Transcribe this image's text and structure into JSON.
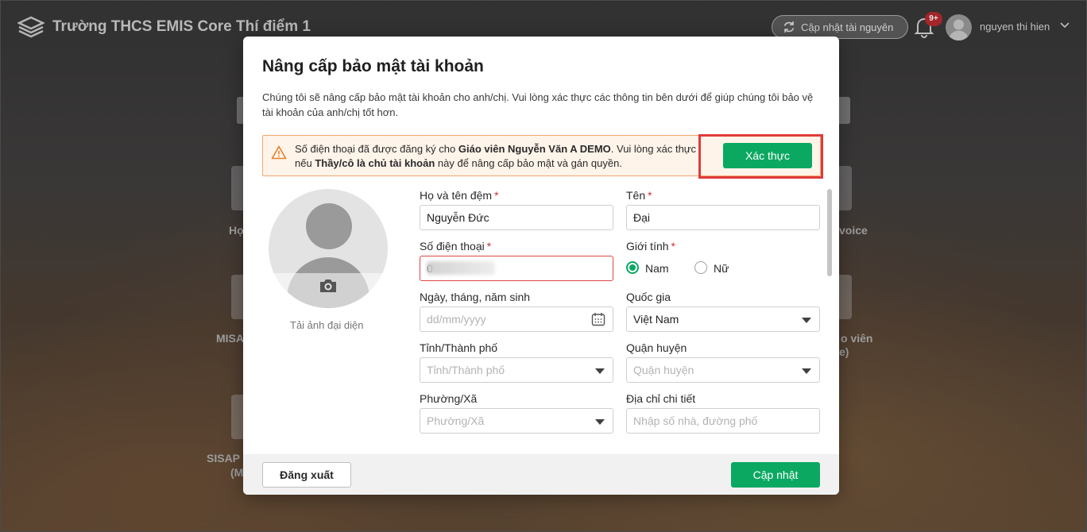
{
  "app": {
    "school_name": "Trường THCS EMIS Core Thí điểm 1",
    "sync_label": "Cập nhật tài nguyên",
    "notification_badge": "9+",
    "user_name": "nguyen thi hien",
    "bg_labels": [
      "Họ",
      "voice",
      "MISA",
      "o viên",
      "e)",
      "SISAP",
      "(M"
    ]
  },
  "modal": {
    "title": "Nâng cấp bảo mật tài khoản",
    "description": "Chúng tôi sẽ nâng cấp bảo mật tài khoản cho anh/chị. Vui lòng xác thực các thông tin bên dưới để giúp chúng tôi bảo vệ tài khoản của anh/chị tốt hơn.",
    "alert": {
      "part1": "Số điện thoại đã được đăng ký cho ",
      "bold1": "Giáo viên Nguyễn Văn A DEMO",
      "part2": ". Vui lòng xác thực nếu ",
      "bold2": "Thầy/cô là chủ tài khoản",
      "part3": " này để nâng cấp bảo mật và gán quyền.",
      "verify_label": "Xác thực"
    },
    "avatar_caption": "Tải ảnh đại diện",
    "form": {
      "middle_name": {
        "label": "Họ và tên đệm",
        "value": "Nguyễn Đức"
      },
      "first_name": {
        "label": "Tên",
        "value": "Đại"
      },
      "phone": {
        "label": "Số điện thoại",
        "value": "0"
      },
      "gender": {
        "label": "Giới tính",
        "options": [
          "Nam",
          "Nữ"
        ],
        "selected": "Nam"
      },
      "dob": {
        "label": "Ngày, tháng, năm sinh",
        "placeholder": "dd/mm/yyyy"
      },
      "country": {
        "label": "Quốc gia",
        "value": "Việt Nam"
      },
      "province": {
        "label": "Tỉnh/Thành phố",
        "placeholder": "Tỉnh/Thành phố"
      },
      "district": {
        "label": "Quận huyện",
        "placeholder": "Quận huyện"
      },
      "ward": {
        "label": "Phường/Xã",
        "placeholder": "Phường/Xã"
      },
      "address": {
        "label": "Địa chỉ chi tiết",
        "placeholder": "Nhập số nhà, đường phố"
      }
    },
    "footer": {
      "logout_label": "Đăng xuất",
      "update_label": "Cập nhật"
    }
  },
  "colors": {
    "primary": "#0ba862",
    "alert_border": "#f3a86d",
    "alert_bg": "#fff4ea",
    "highlight": "#e03a3a",
    "required": "#d32f2f"
  }
}
